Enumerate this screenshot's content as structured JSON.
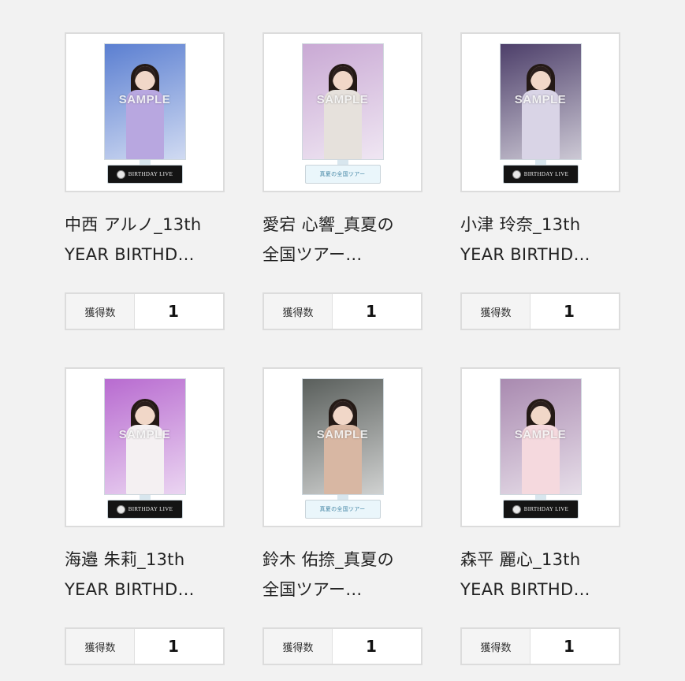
{
  "count_label": "獲得数",
  "sample_watermark": "SAMPLE",
  "base_texts": {
    "dark": "BIRTHDAY LIVE",
    "light": "真夏の全国ツアー"
  },
  "items": [
    {
      "title_line1": "中西 アルノ_13th",
      "title_line2": "YEAR BIRTHD…",
      "count": "1",
      "base_style": "dark",
      "bg_color": "#5b7fd1",
      "outfit_color": "#b8a7e0"
    },
    {
      "title_line1": "愛宕 心響_真夏の",
      "title_line2": "全国ツアー…",
      "count": "1",
      "base_style": "light",
      "bg_color": "#c9a9d4",
      "outfit_color": "#e6e1dc"
    },
    {
      "title_line1": "小津 玲奈_13th",
      "title_line2": "YEAR BIRTHD…",
      "count": "1",
      "base_style": "dark",
      "bg_color": "#4d3f6a",
      "outfit_color": "#d9d4e6"
    },
    {
      "title_line1": "海邉 朱莉_13th",
      "title_line2": "YEAR BIRTHD…",
      "count": "1",
      "base_style": "dark",
      "bg_color": "#b86bd0",
      "outfit_color": "#f4f0f2"
    },
    {
      "title_line1": "鈴木 佑捺_真夏の",
      "title_line2": "全国ツアー…",
      "count": "1",
      "base_style": "light",
      "bg_color": "#5a5f5c",
      "outfit_color": "#d8b7a3"
    },
    {
      "title_line1": "森平 麗心_13th",
      "title_line2": "YEAR BIRTHD…",
      "count": "1",
      "base_style": "dark",
      "bg_color": "#a98ab0",
      "outfit_color": "#f5d9de"
    }
  ]
}
